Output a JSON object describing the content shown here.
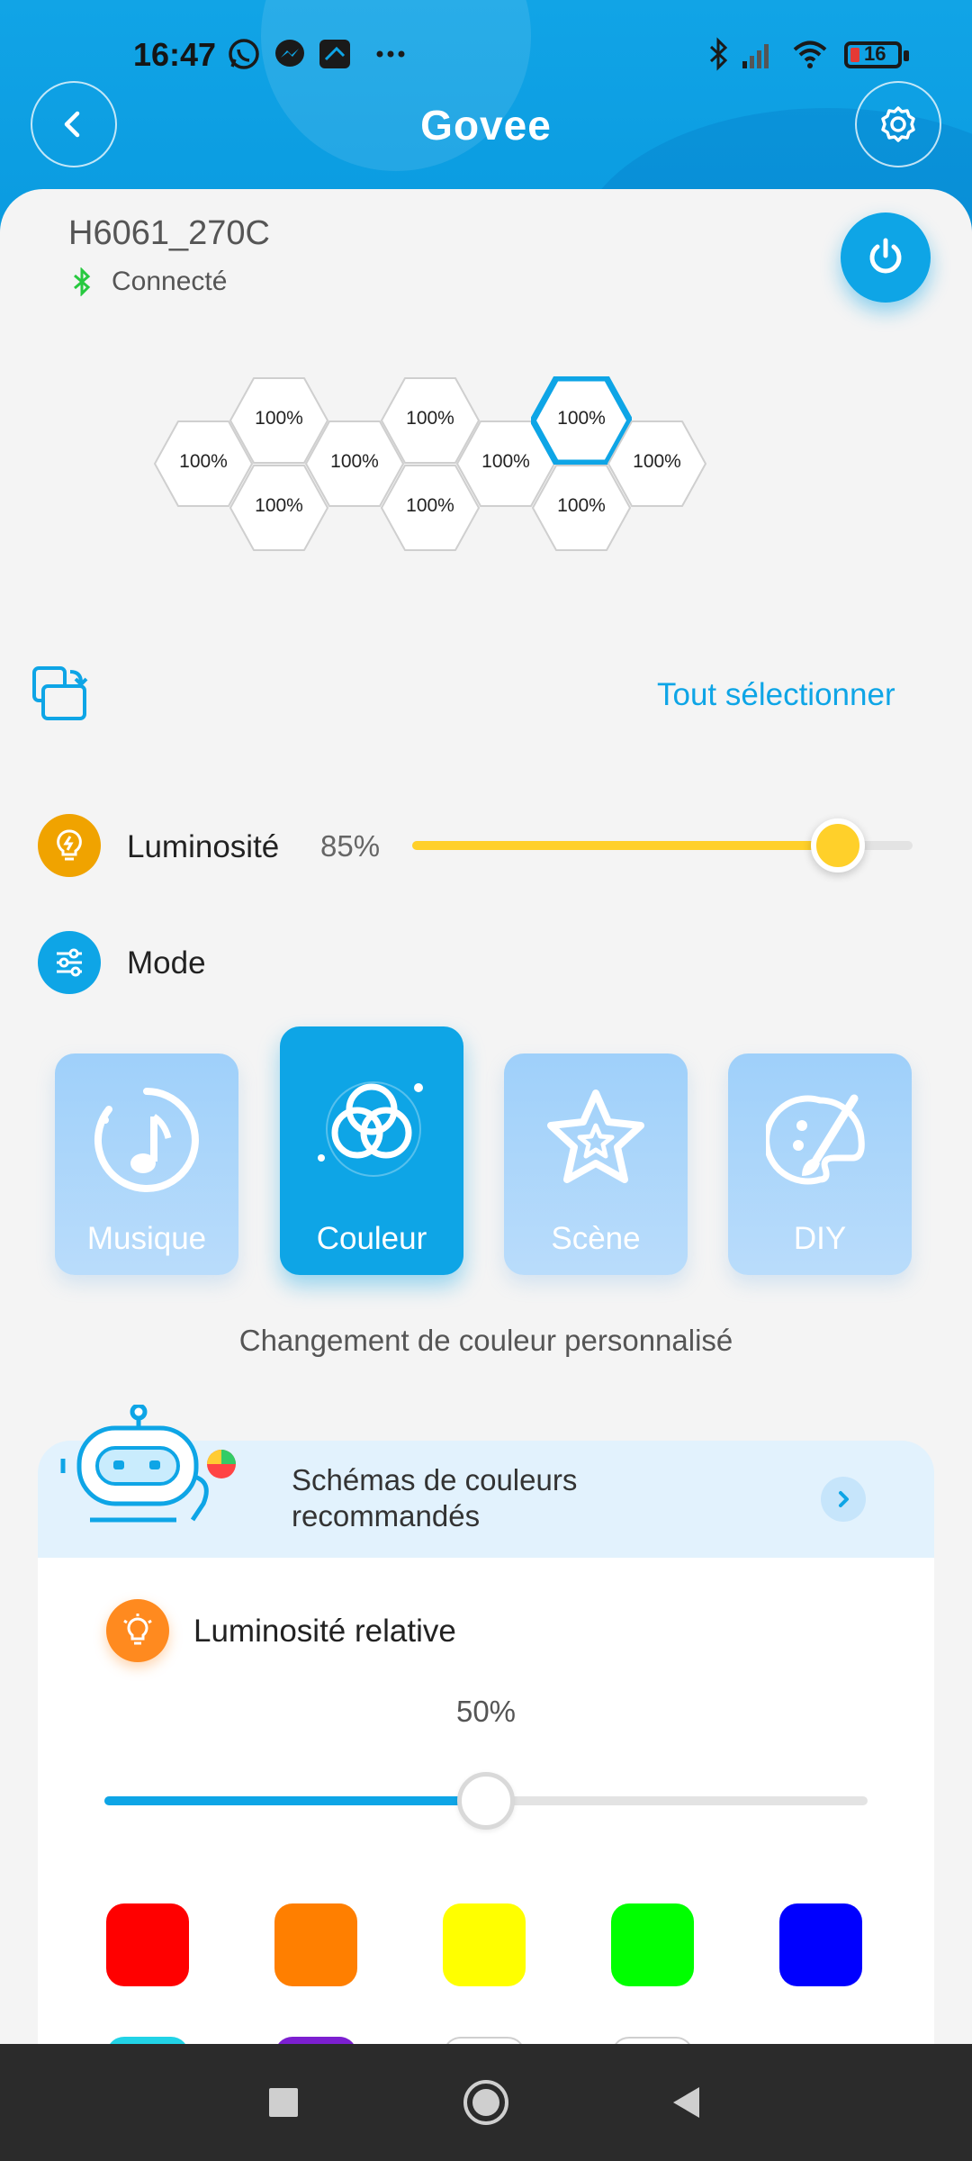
{
  "status_bar": {
    "time": "16:47",
    "battery": "16",
    "icons": [
      "whatsapp-icon",
      "messenger-icon",
      "camera-app-icon",
      "more-dots-icon",
      "bluetooth-icon",
      "signal-icon",
      "wifi-icon",
      "battery-icon"
    ]
  },
  "header": {
    "brand": "Govee",
    "back_icon": "chevron-left-icon",
    "settings_icon": "gear-icon"
  },
  "device": {
    "name": "H6061_270C",
    "status": "Connecté",
    "power_icon": "power-icon"
  },
  "panels": {
    "labels": [
      "100%",
      "100%",
      "100%",
      "100%",
      "100%",
      "100%",
      "100%",
      "100%",
      "100%",
      "100%"
    ],
    "selected_index": 7
  },
  "toolbar": {
    "select_all": "Tout sélectionner"
  },
  "brightness": {
    "label": "Luminosité",
    "value_text": "85%",
    "value": 0.85,
    "color": "#ffd02a"
  },
  "mode": {
    "label": "Mode",
    "options": [
      {
        "label": "Musique",
        "icon": "music-note-icon",
        "active": false
      },
      {
        "label": "Couleur",
        "icon": "color-circles-icon",
        "active": true
      },
      {
        "label": "Scène",
        "icon": "star-icon",
        "active": false
      },
      {
        "label": "DIY",
        "icon": "palette-brush-icon",
        "active": false
      }
    ],
    "description": "Changement de couleur personnalisé"
  },
  "recommended": {
    "line1": "Schémas de couleurs",
    "line2": "recommandés"
  },
  "relative_brightness": {
    "label": "Luminosité relative",
    "value_text": "50%",
    "value": 0.5
  },
  "swatches": [
    "#ff0000",
    "#ff7f00",
    "#ffff00",
    "#00ff00",
    "#0000ff"
  ],
  "swatches_row2": [
    "#22d3e6",
    "#7c1fd0",
    "#ffffff",
    "#ffffff"
  ],
  "colors": {
    "accent": "#0ea5e6",
    "brightness_icon_bg": "#f0a300",
    "relative_icon_bg": "#ff8a1f"
  },
  "navbar": {
    "icons": [
      "recents-square-icon",
      "home-circle-icon",
      "back-triangle-icon"
    ]
  }
}
